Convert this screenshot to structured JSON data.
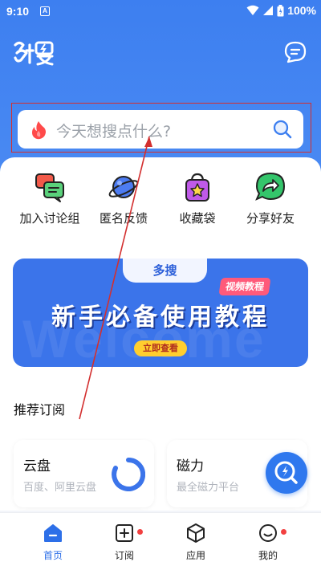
{
  "status_bar": {
    "time": "9:10",
    "notification": "A",
    "battery": "100%"
  },
  "header": {
    "logo_text": "多搜"
  },
  "search": {
    "placeholder": "今天想搜点什么?"
  },
  "quick_actions": [
    {
      "label": "加入讨论组",
      "icon": "chat-bubbles-icon"
    },
    {
      "label": "匿名反馈",
      "icon": "planet-icon"
    },
    {
      "label": "收藏袋",
      "icon": "shopping-bag-icon"
    },
    {
      "label": "分享好友",
      "icon": "share-icon"
    }
  ],
  "banner": {
    "logo": "多搜",
    "badge": "视频教程",
    "title": "新手必备使用教程",
    "watermark": "Welcome",
    "button": "立即查看"
  },
  "recommend": {
    "title": "推荐订阅",
    "cards": [
      {
        "title": "云盘",
        "desc": "百度、阿里云盘"
      },
      {
        "title": "磁力",
        "desc": "最全磁力平台"
      }
    ]
  },
  "bottom_nav": [
    {
      "label": "首页",
      "active": true,
      "badge": false
    },
    {
      "label": "订阅",
      "active": false,
      "badge": true
    },
    {
      "label": "应用",
      "active": false,
      "badge": false
    },
    {
      "label": "我的",
      "active": false,
      "badge": true
    }
  ],
  "colors": {
    "primary": "#3d7ff0",
    "annotation": "#d32f2f",
    "badge_red": "#f24040"
  }
}
